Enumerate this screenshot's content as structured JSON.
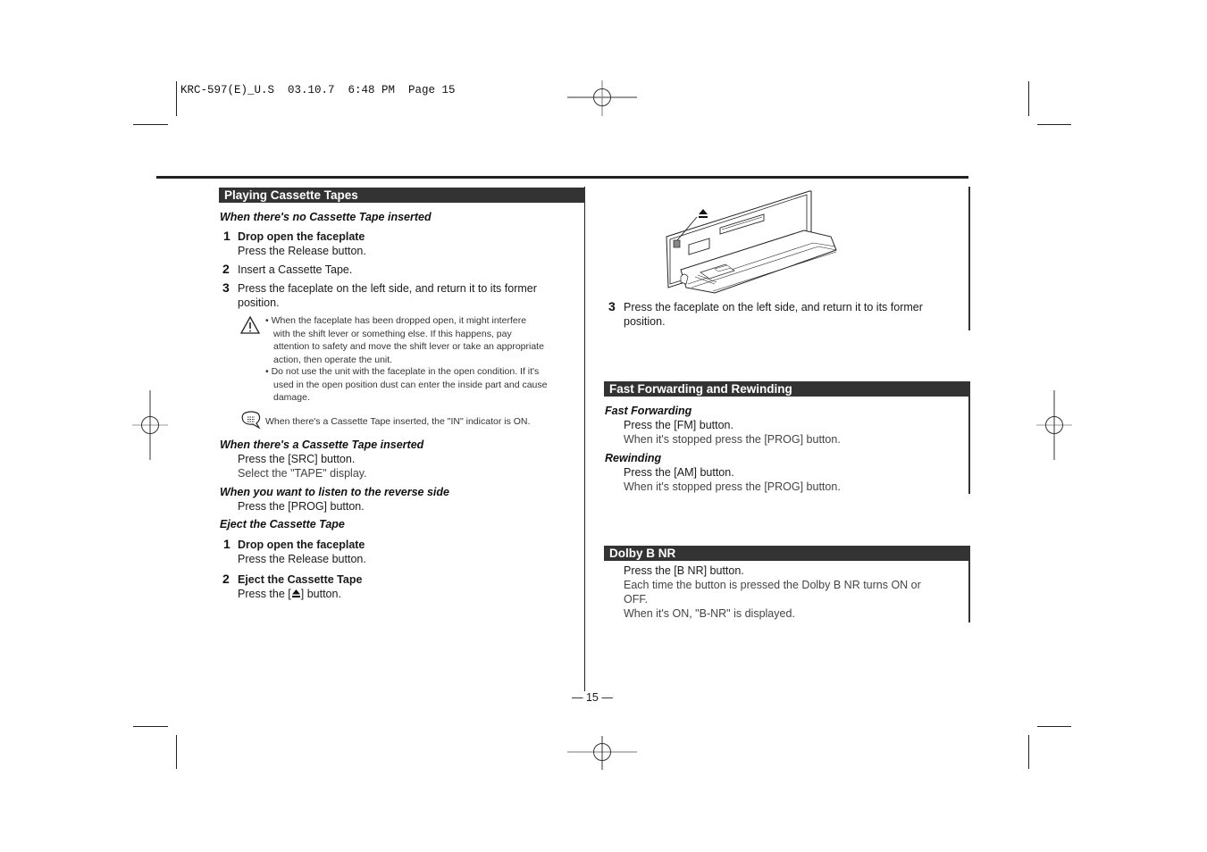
{
  "slug": {
    "text": "KRC-597(E)_U.S  03.10.7  6:48 PM  Page 15"
  },
  "left_column": {
    "section_title": "Playing Cassette Tapes",
    "no_tape": {
      "heading": "When there's no Cassette Tape inserted",
      "steps": [
        {
          "number": "1",
          "title": "Drop open the faceplate",
          "text": "Press the Release button."
        },
        {
          "number": "2",
          "text": "Insert a Cassette Tape."
        },
        {
          "number": "3",
          "text_line1": "Press the faceplate on the left side, and return it to its former",
          "text_line2": "position."
        }
      ]
    },
    "caution": {
      "icon": "warning-triangle-icon",
      "bullets": [
        [
          "• When the faceplate has been dropped open, it might interfere",
          "with the shift lever or something else. If this happens, pay",
          "attention to safety and move the shift lever or take an appropriate",
          "action, then operate the unit."
        ],
        [
          "• Do not use the unit with the faceplate in the open condition. If it's",
          "used in the open position dust can enter the inside part and cause",
          "damage."
        ]
      ]
    },
    "info_note": {
      "icon": "speech-bubble-note-icon",
      "text": "When there's a Cassette Tape inserted, the \"IN\" indicator is ON."
    },
    "tape_inserted": {
      "heading": "When there's a Cassette Tape inserted",
      "line1": "Press the [SRC] button.",
      "line2": "Select the \"TAPE\" display."
    },
    "reverse_side": {
      "heading": "When you want to listen to the reverse side",
      "line1": "Press the [PROG] button."
    },
    "eject": {
      "heading": "Eject the Cassette Tape",
      "steps": [
        {
          "number": "1",
          "title": "Drop open the faceplate",
          "text": "Press the Release button."
        },
        {
          "number": "2",
          "title": "Eject the Cassette Tape",
          "text_before": "Press the [",
          "icon": "eject-icon",
          "text_after": "] button."
        }
      ]
    }
  },
  "right_column": {
    "illustration": {
      "name": "faceplate-open-illustration",
      "icon": "eject-icon"
    },
    "step3": {
      "number": "3",
      "text_line1": "Press the faceplate on the left side, and return it to its former",
      "text_line2": "position."
    },
    "fast_forwarding_section": {
      "title": "Fast Forwarding and Rewinding",
      "fast_forwarding": {
        "heading": "Fast Forwarding",
        "line1": "Press the [FM] button.",
        "line2": "When it's stopped press the [PROG] button."
      },
      "rewinding": {
        "heading": "Rewinding",
        "line1": "Press the [AM] button.",
        "line2": "When it's stopped press the [PROG] button."
      }
    },
    "dolby_section": {
      "title": "Dolby B NR",
      "line1": "Press the [B NR] button.",
      "line2": "Each time the button is pressed the Dolby B NR turns ON or",
      "line3": "OFF.",
      "line4": "When it's ON, \"B-NR\" is displayed."
    }
  },
  "footer": {
    "page_number": "— 15 —"
  }
}
